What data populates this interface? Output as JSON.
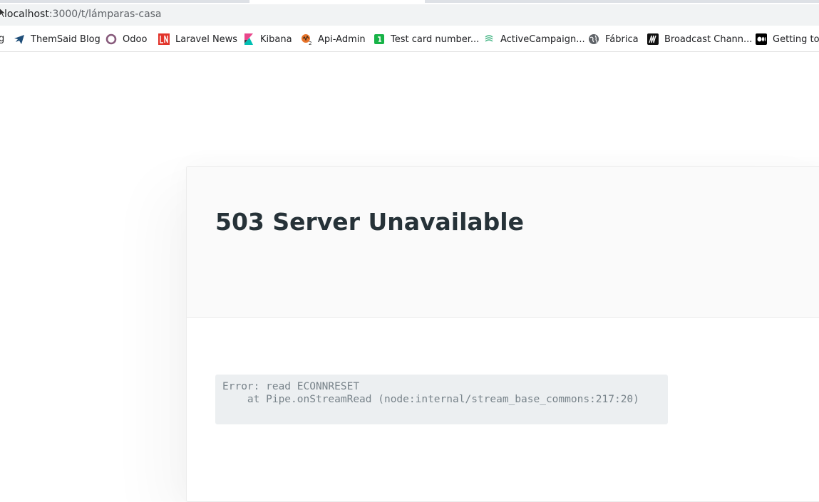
{
  "browser": {
    "url_host": "localhost",
    "url_path": ":3000/t/lámparas-casa",
    "bookmark_partial": "g",
    "bookmarks": [
      {
        "label": "ThemSaid Blog",
        "icon": "bird-icon"
      },
      {
        "label": "Odoo",
        "icon": "odoo-circle-icon"
      },
      {
        "label": "Laravel News",
        "icon": "laravel-news-icon"
      },
      {
        "label": "Kibana",
        "icon": "kibana-icon"
      },
      {
        "label": "Api-Admin",
        "icon": "api-admin-icon"
      },
      {
        "label": "Test card number...",
        "icon": "card-icon"
      },
      {
        "label": "ActiveCampaign...",
        "icon": "activecampaign-icon"
      },
      {
        "label": "Fábrica",
        "icon": "globe-icon"
      },
      {
        "label": "Broadcast Chann...",
        "icon": "broadcast-icon"
      },
      {
        "label": "Getting to",
        "icon": "medium-icon"
      }
    ]
  },
  "page": {
    "title": "503 Server Unavailable",
    "error_text": "Error: read ECONNRESET\n    at Pipe.onStreamRead (node:internal/stream_base_commons:217:20)"
  },
  "colors": {
    "title": "#263238",
    "error_bg": "#eceff1",
    "error_text": "#78838a",
    "card_head_bg": "#fafafa"
  }
}
